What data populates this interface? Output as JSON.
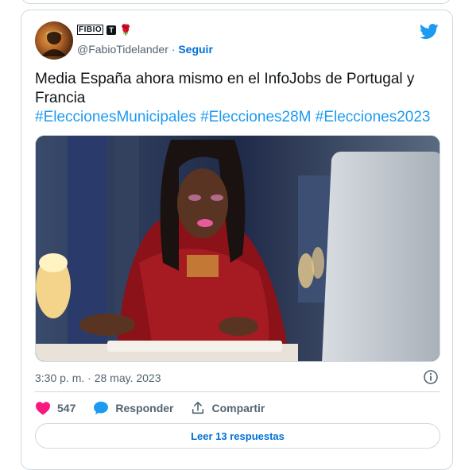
{
  "author": {
    "display_name_box": "FIBIO",
    "emoji_badge": "T",
    "emoji_rose": "🌹",
    "handle": "@FabioTidelander",
    "separator": " · ",
    "follow_label": "Seguir"
  },
  "tweet": {
    "text": "Media España ahora mismo en el InfoJobs de Portugal y Francia",
    "hashtags": [
      "#EleccionesMunicipales",
      "#Elecciones28M",
      "#Elecciones2023"
    ],
    "timestamp": "3:30 p. m. · 28 may. 2023"
  },
  "actions": {
    "likes": "547",
    "reply_label": "Responder",
    "share_label": "Compartir"
  },
  "read_replies_label": "Leer 13 respuestas",
  "colors": {
    "accent": "#1d9bf0",
    "link": "#006fd6",
    "like": "#f91880",
    "muted": "#536471",
    "border": "#cfd9de"
  }
}
